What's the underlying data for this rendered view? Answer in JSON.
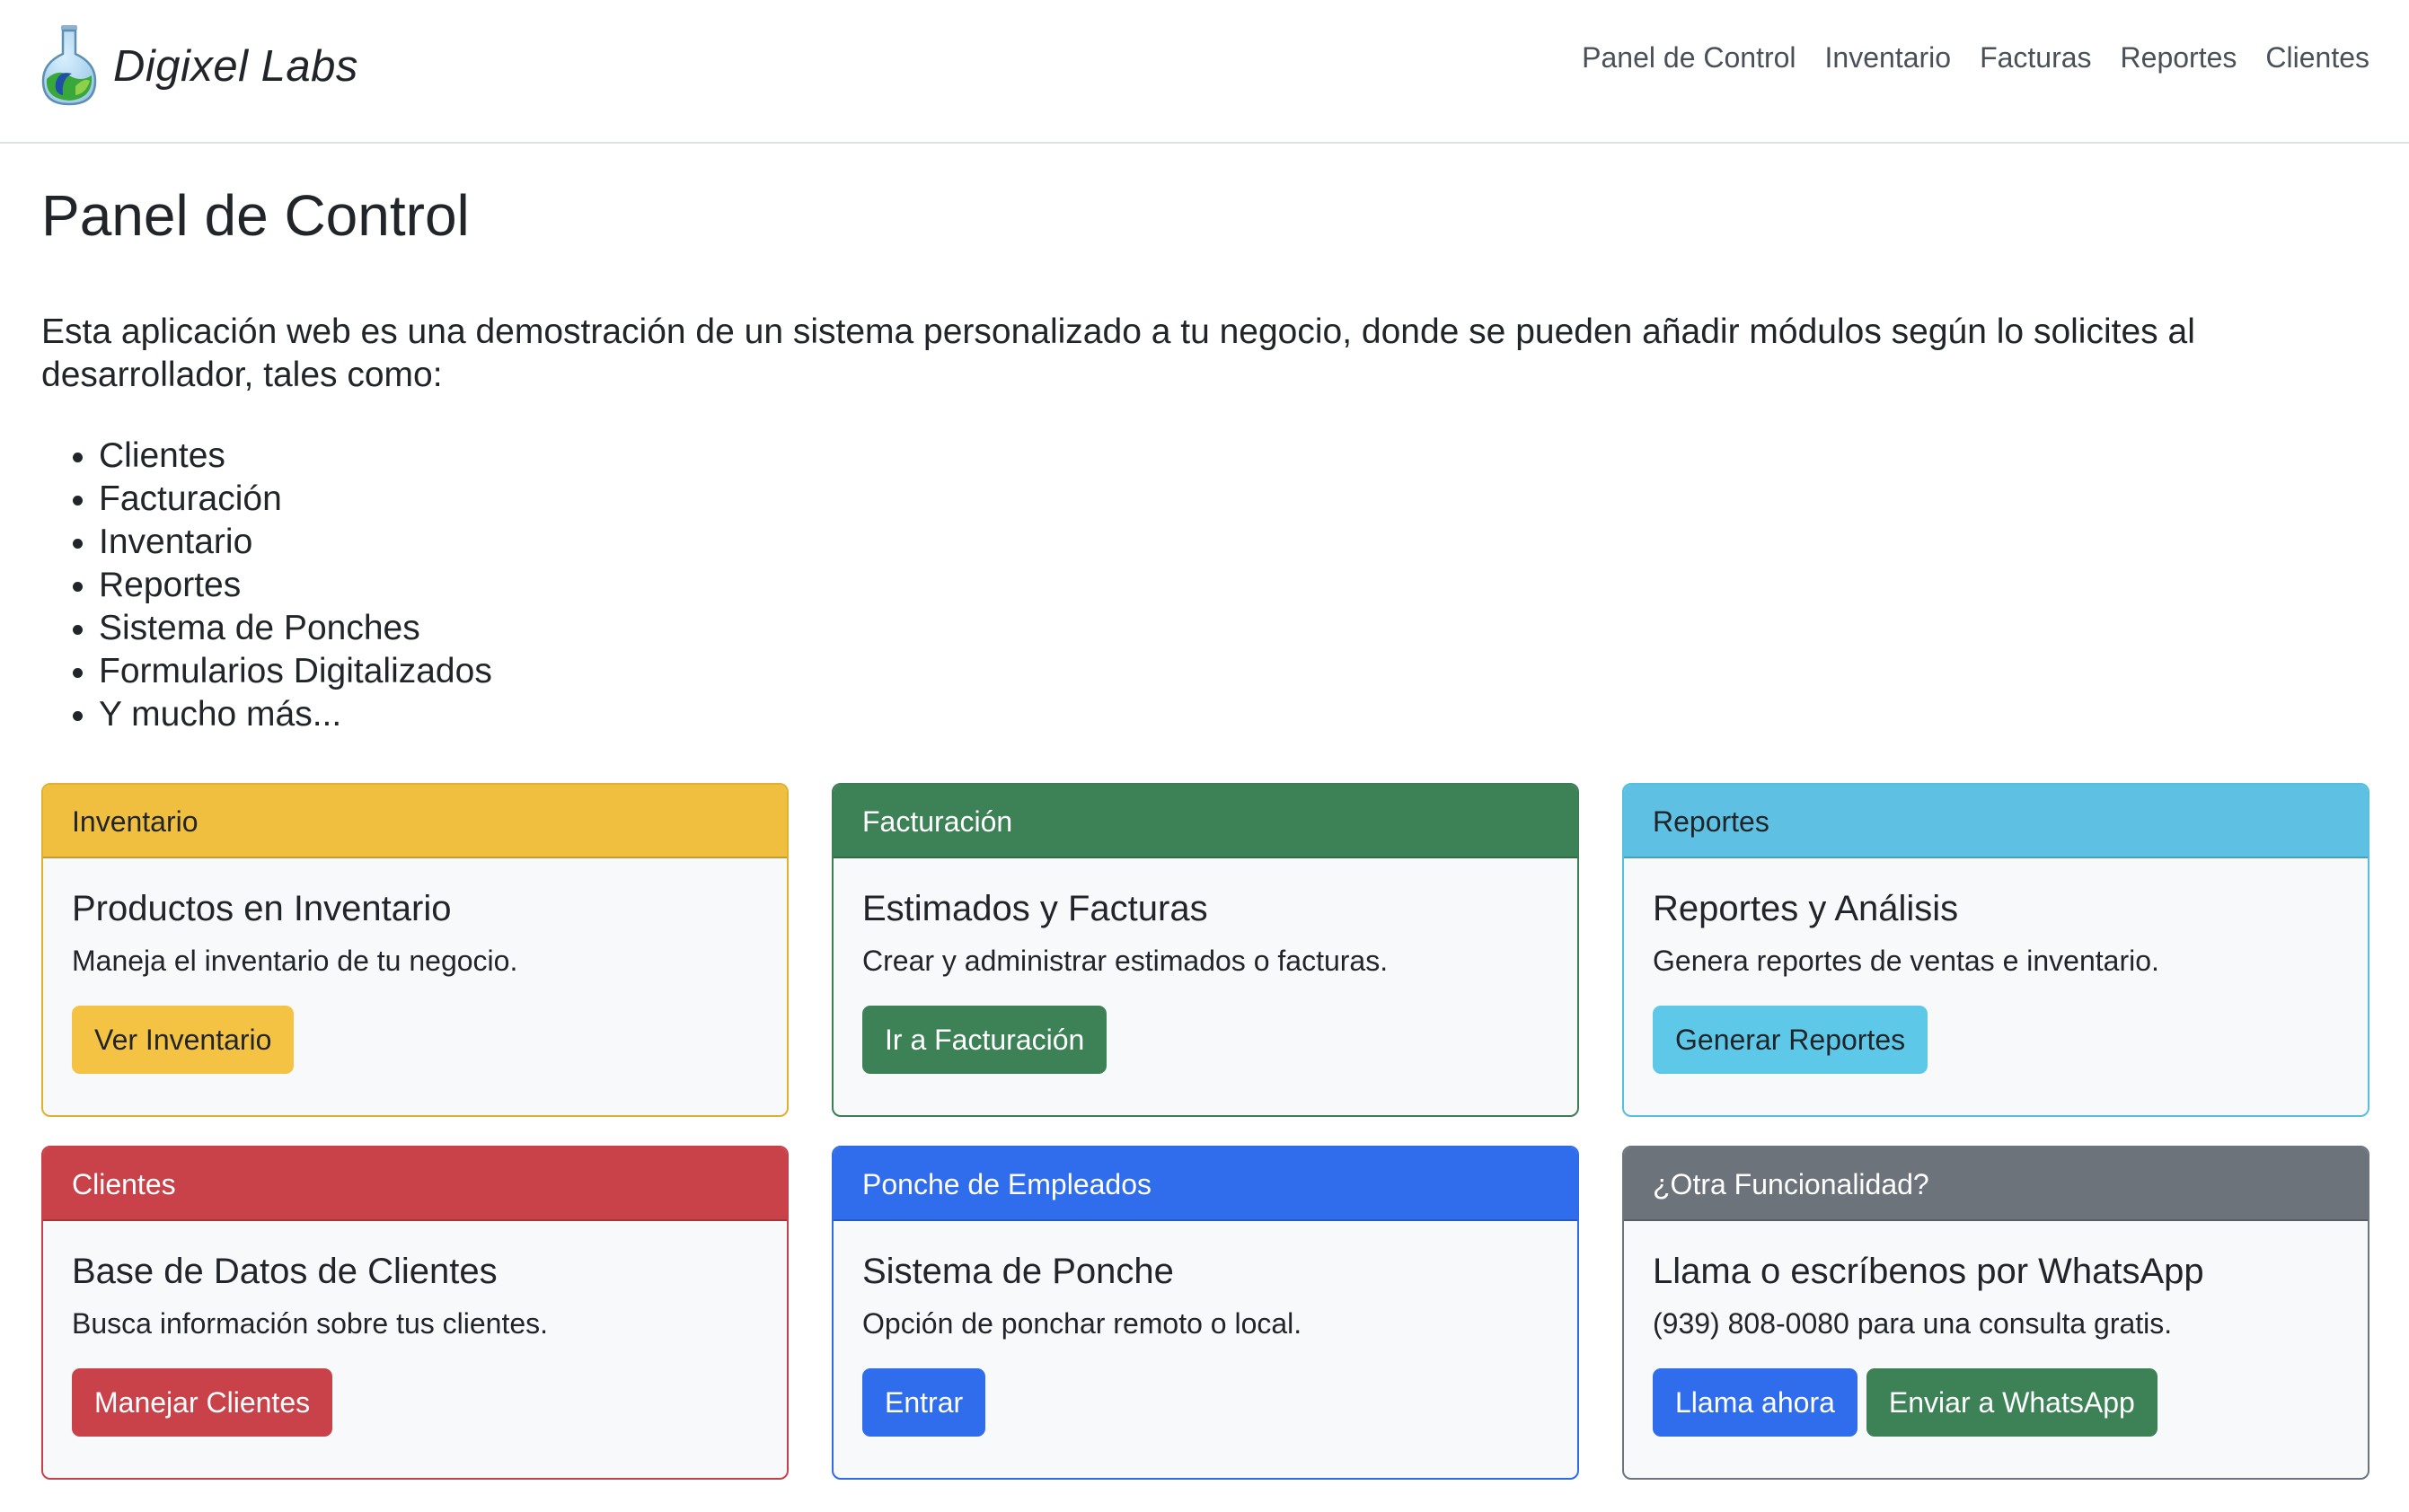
{
  "brand": {
    "name": "Digixel Labs",
    "logo_icon": "flask-logo-icon"
  },
  "nav": {
    "items": [
      {
        "label": "Panel de Control"
      },
      {
        "label": "Inventario"
      },
      {
        "label": "Facturas"
      },
      {
        "label": "Reportes"
      },
      {
        "label": "Clientes"
      }
    ]
  },
  "main": {
    "title": "Panel de Control",
    "lead": "Esta aplicación web es una demostración de un sistema personalizado a tu negocio, donde se pueden añadir módulos según lo solicites al desarrollador, tales como:",
    "features": [
      "Clientes",
      "Facturación",
      "Inventario",
      "Reportes",
      "Sistema de Ponches",
      "Formularios Digitalizados",
      "Y mucho más..."
    ]
  },
  "cards": [
    {
      "variant": "warning",
      "color": "#f0bf3f",
      "header": "Inventario",
      "title": "Productos en Inventario",
      "text": "Maneja el inventario de tu negocio.",
      "buttons": [
        {
          "label": "Ver Inventario"
        }
      ]
    },
    {
      "variant": "success",
      "color": "#3d8156",
      "header": "Facturación",
      "title": "Estimados y Facturas",
      "text": "Crear y administrar estimados o facturas.",
      "buttons": [
        {
          "label": "Ir a Facturación"
        }
      ]
    },
    {
      "variant": "info",
      "color": "#5ec1e3",
      "header": "Reportes",
      "title": "Reportes y Análisis",
      "text": "Genera reportes de ventas e inventario.",
      "buttons": [
        {
          "label": "Generar Reportes"
        }
      ]
    },
    {
      "variant": "danger",
      "color": "#c94249",
      "header": "Clientes",
      "title": "Base de Datos de Clientes",
      "text": "Busca información sobre tus clientes.",
      "buttons": [
        {
          "label": "Manejar Clientes"
        }
      ]
    },
    {
      "variant": "primary",
      "color": "#2f6ded",
      "header": "Ponche de Empleados",
      "title": "Sistema de Ponche",
      "text": "Opción de ponchar remoto o local.",
      "buttons": [
        {
          "label": "Entrar"
        }
      ]
    },
    {
      "variant": "secondary",
      "color": "#6c737b",
      "header": "¿Otra Funcionalidad?",
      "title": "Llama o escríbenos por WhatsApp",
      "text": "(939) 808-0080 para una consulta gratis.",
      "buttons": [
        {
          "label": "Llama ahora"
        },
        {
          "label": "Enviar a WhatsApp"
        }
      ]
    }
  ]
}
